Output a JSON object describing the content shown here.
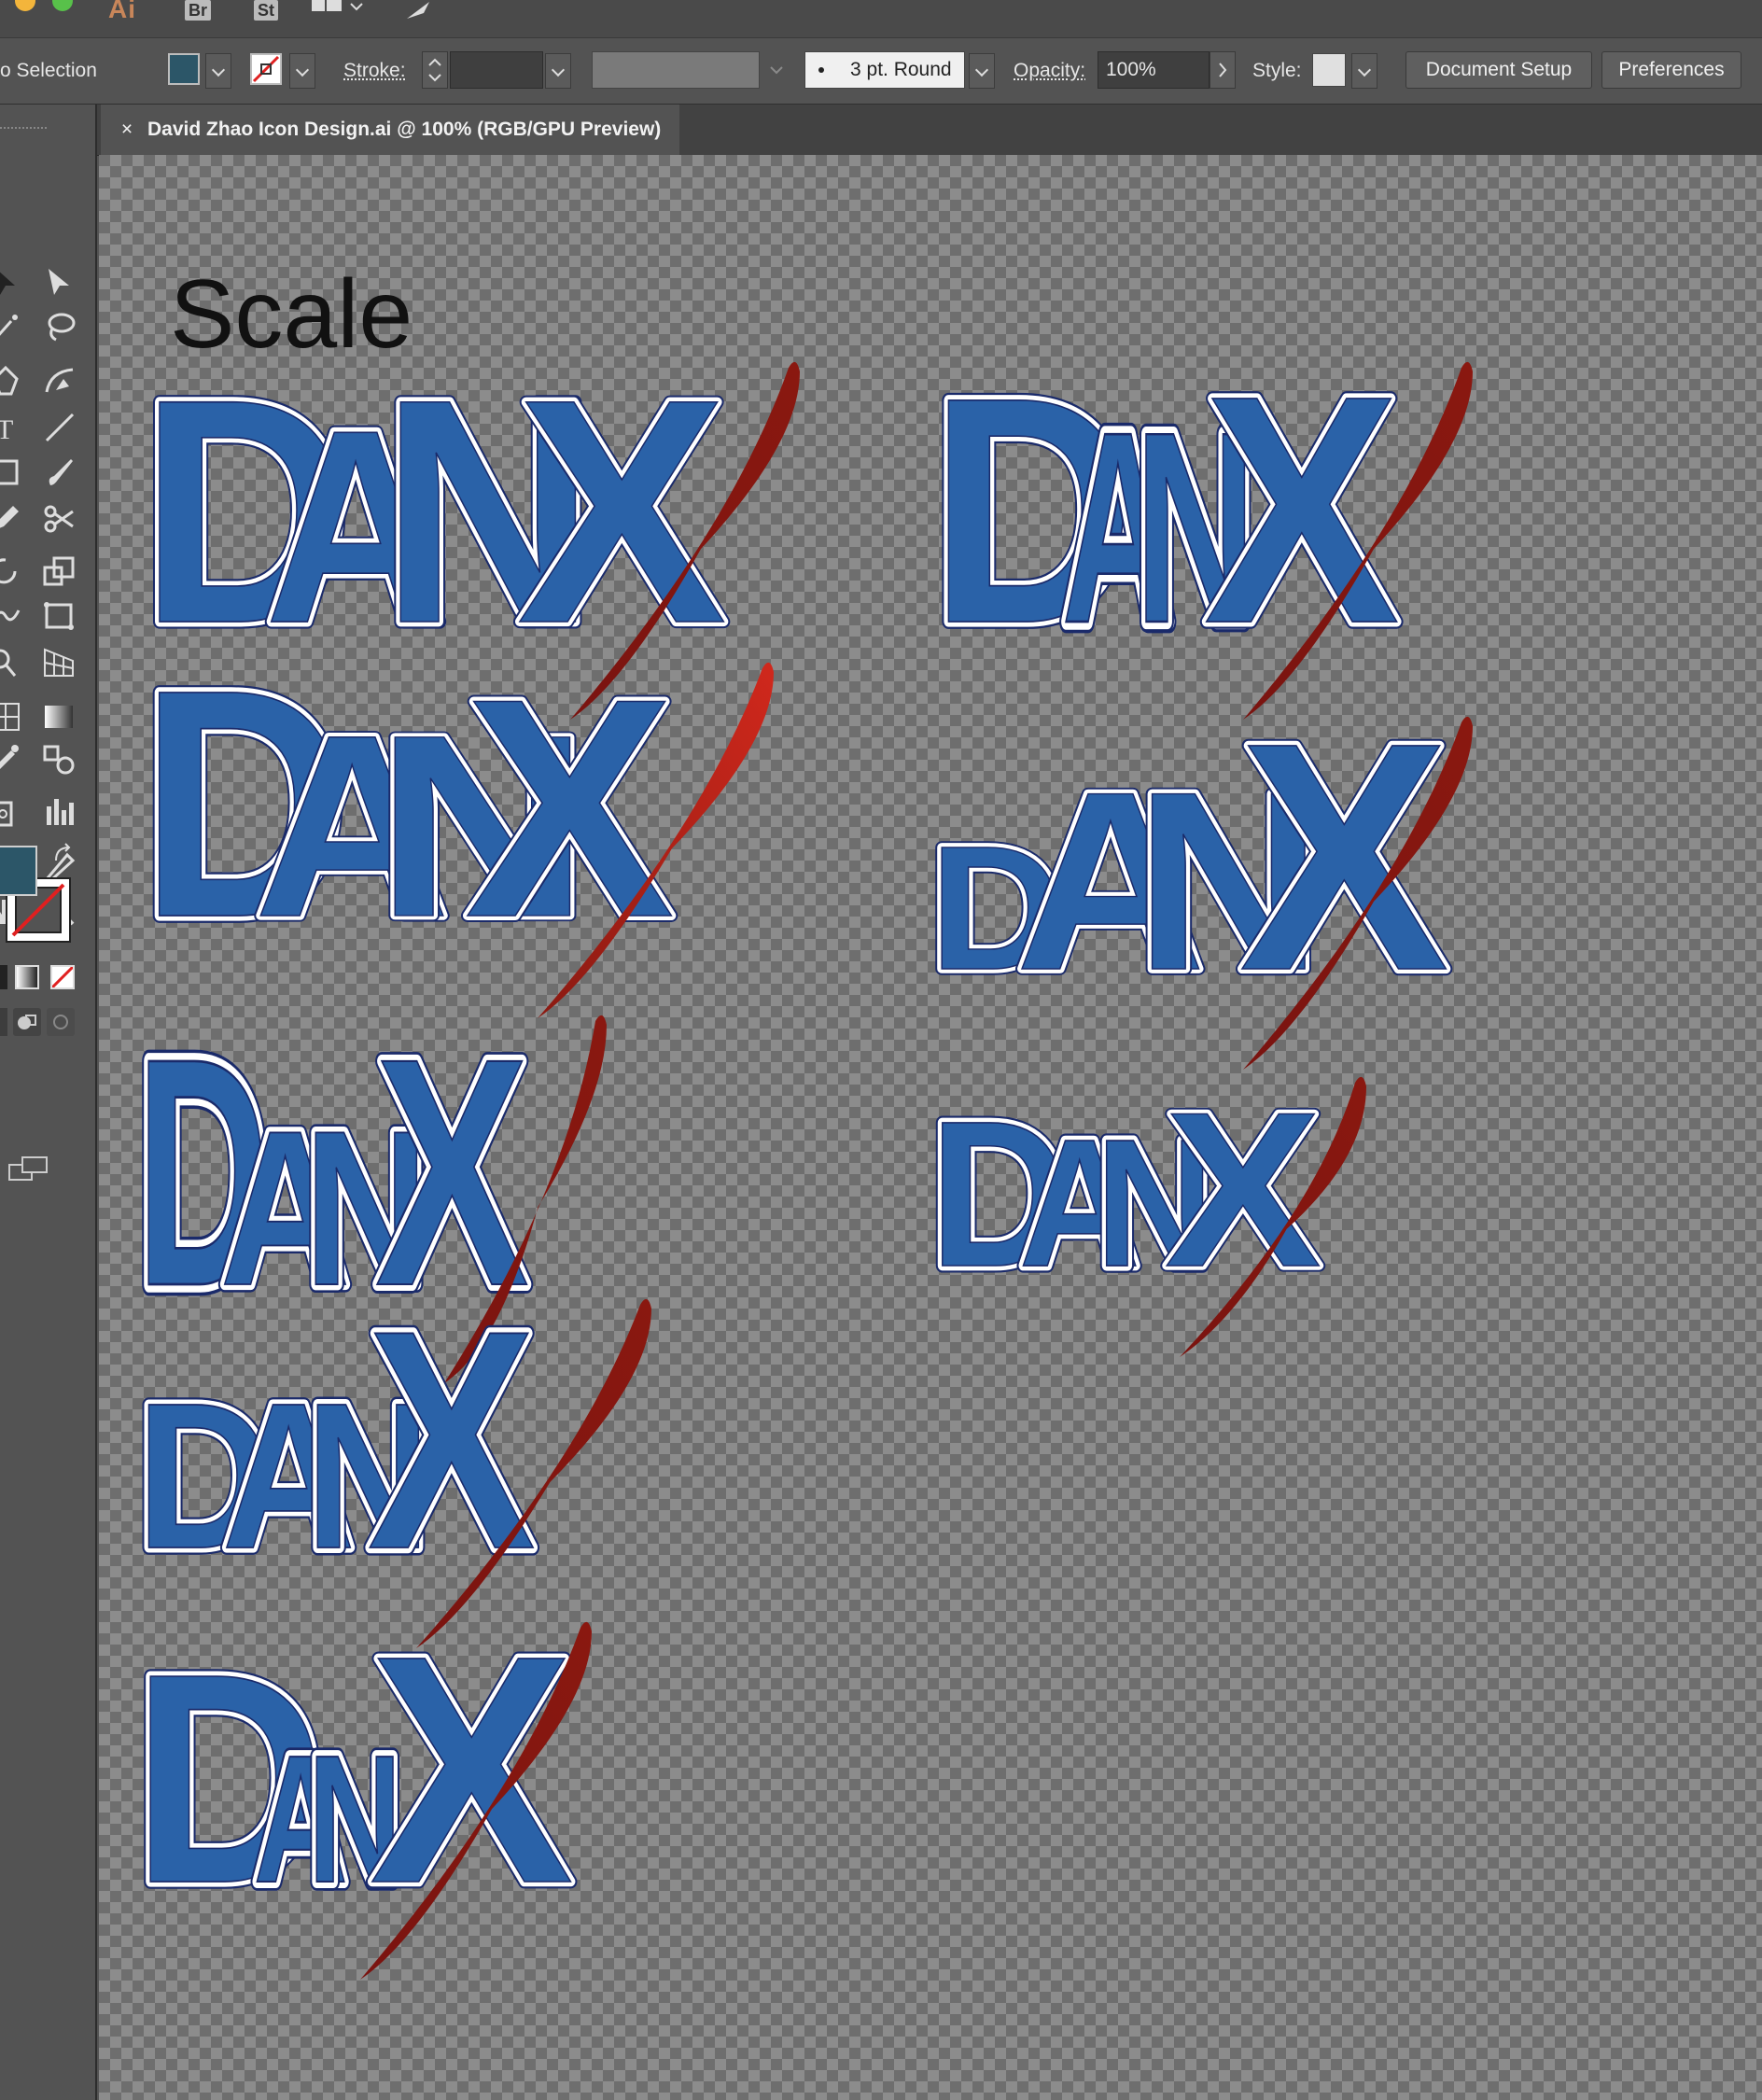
{
  "titlebar": {
    "app_logo": "Ai",
    "bridge_label": "Br",
    "stock_label": "St"
  },
  "control_bar": {
    "selection_label": "No Selection",
    "visible_selection_label": "o Selection",
    "fill_color": "#2c5668",
    "stroke_label": "Stroke:",
    "brush_label": "3 pt. Round",
    "opacity_label": "Opacity:",
    "opacity_value": "100%",
    "style_label": "Style:",
    "document_setup_label": "Document Setup",
    "preferences_label": "Preferences"
  },
  "tab": {
    "close_symbol": "×",
    "title": "David Zhao Icon Design.ai @ 100% (RGB/GPU Preview)"
  },
  "tools": {
    "fill_swatch_color": "#2c5668",
    "icons": [
      "selection-tool",
      "direct-selection-tool",
      "magic-wand-tool",
      "lasso-tool",
      "pen-tool",
      "curvature-tool",
      "type-tool",
      "line-segment-tool",
      "rectangle-tool",
      "paintbrush-tool",
      "pencil-tool",
      "scissors-tool",
      "rotate-tool",
      "scale-tool",
      "warp-tool",
      "free-transform-tool",
      "shape-builder-tool",
      "perspective-grid-tool",
      "mesh-tool",
      "gradient-tool",
      "eyedropper-tool",
      "blend-tool",
      "symbol-sprayer-tool",
      "column-graph-tool",
      "artboard-tool",
      "slice-tool",
      "hand-tool",
      "zoom-tool"
    ]
  },
  "artboard": {
    "heading": "Scale",
    "logo_text_parts": [
      "D",
      "A",
      "N",
      "X"
    ],
    "colors": {
      "letter_fill": "#2a62a8",
      "letter_outline": "#ffffff",
      "letter_edge": "#1a2a6a",
      "slash_light": "#c0251b",
      "slash_dark": "#7a1410"
    }
  }
}
